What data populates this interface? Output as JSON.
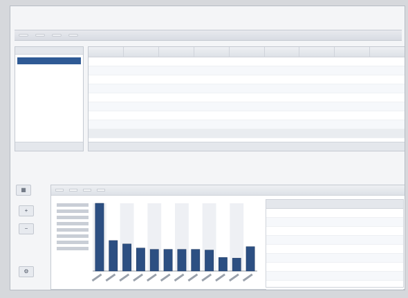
{
  "header": {
    "app_title": "",
    "nav": [
      "",
      "",
      "",
      "",
      "",
      "",
      "",
      "",
      ""
    ],
    "toolbar": [
      "",
      "",
      "",
      ""
    ]
  },
  "leftnav": {
    "items": [
      "",
      ""
    ],
    "footer": ""
  },
  "grid": {
    "columns": [
      "",
      "",
      "",
      "",
      "",
      "",
      "",
      "",
      ""
    ],
    "rows": [
      [
        "",
        "",
        "",
        "",
        "",
        "",
        "",
        "",
        ""
      ],
      [
        "",
        "",
        "",
        "",
        "",
        "",
        "",
        "",
        ""
      ],
      [
        "",
        "",
        "",
        "",
        "",
        "",
        "",
        "",
        ""
      ],
      [
        "",
        "",
        "",
        "",
        "",
        "",
        "",
        "",
        ""
      ],
      [
        "",
        "",
        "",
        "",
        "",
        "",
        "",
        "",
        ""
      ],
      [
        "",
        "",
        "",
        "",
        "",
        "",
        "",
        "",
        ""
      ],
      [
        "",
        "",
        "",
        "",
        "",
        "",
        "",
        "",
        ""
      ],
      [
        "",
        "",
        "",
        "",
        "",
        "",
        "",
        "",
        ""
      ],
      [
        "",
        "",
        "",
        "",
        "",
        "",
        "",
        "",
        ""
      ]
    ]
  },
  "panel": {
    "toolbar": [
      "",
      "",
      "",
      ""
    ]
  },
  "chart_data": {
    "type": "bar",
    "categories": [
      "",
      "",
      "",
      "",
      "",
      "",
      "",
      "",
      "",
      "",
      ""
    ],
    "values": [
      1.0,
      0.45,
      0.4,
      0.34,
      0.32,
      0.32,
      0.32,
      0.32,
      0.31,
      0.2,
      0.19,
      0.36
    ],
    "title": "",
    "xlabel": "",
    "ylabel": "",
    "ylim": [
      0,
      1.0
    ],
    "grid": true,
    "bar_color": "#2c4f82"
  },
  "right_table": {
    "columns": [
      "",
      ""
    ],
    "rows": [
      [
        "",
        ""
      ],
      [
        "",
        ""
      ],
      [
        "",
        ""
      ],
      [
        "",
        ""
      ],
      [
        "",
        ""
      ],
      [
        "",
        ""
      ],
      [
        "",
        ""
      ],
      [
        "",
        ""
      ],
      [
        "",
        ""
      ],
      [
        "",
        ""
      ]
    ]
  },
  "colors": {
    "accent": "#2f5a95",
    "bar": "#2c4f82"
  }
}
